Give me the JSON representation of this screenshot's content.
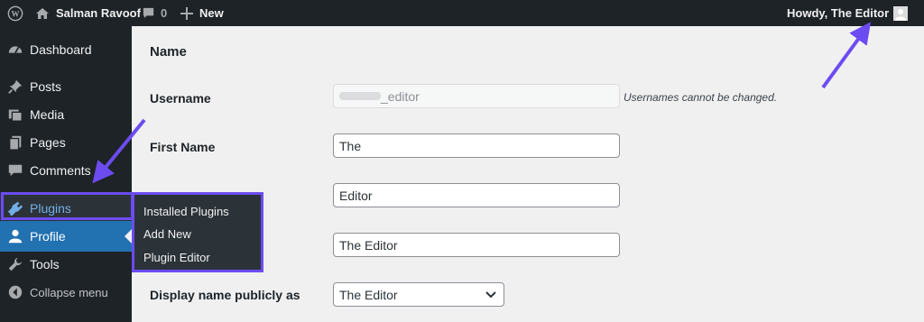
{
  "adminbar": {
    "site_name": "Salman Ravoof",
    "comment_count": "0",
    "new_label": "New",
    "greeting": "Howdy, The Editor"
  },
  "sidebar": {
    "items": [
      {
        "label": "Dashboard",
        "icon": "dashboard-icon"
      },
      {
        "label": "Posts",
        "icon": "pin-icon"
      },
      {
        "label": "Media",
        "icon": "media-icon"
      },
      {
        "label": "Pages",
        "icon": "pages-icon"
      },
      {
        "label": "Comments",
        "icon": "comments-icon"
      },
      {
        "label": "Plugins",
        "icon": "plugin-icon"
      },
      {
        "label": "Profile",
        "icon": "user-icon"
      },
      {
        "label": "Tools",
        "icon": "wrench-icon"
      },
      {
        "label": "Collapse menu",
        "icon": "collapse-icon"
      }
    ]
  },
  "plugins_submenu": {
    "items": [
      "Installed Plugins",
      "Add New",
      "Plugin Editor"
    ]
  },
  "form": {
    "heading": "Name",
    "username": {
      "label": "Username",
      "value": "_editor",
      "description": "Usernames cannot be changed."
    },
    "first_name": {
      "label": "First Name",
      "value": "The"
    },
    "last_name": {
      "value": "Editor"
    },
    "nickname": {
      "value": "The Editor"
    },
    "display_name": {
      "label": "Display name publicly as",
      "value": "The Editor"
    }
  },
  "colors": {
    "adminbar_bg": "#1d2327",
    "sidebar_bg": "#1d2327",
    "active_blue": "#2271b1",
    "plugin_highlight": "#72aee6",
    "annotation_purple": "#6c4cf1"
  }
}
